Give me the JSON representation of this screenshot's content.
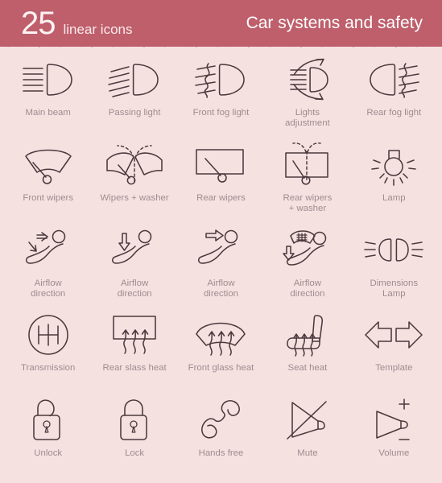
{
  "header": {
    "count": "25",
    "count_label": "linear icons",
    "title": "Car systems and safety",
    "background_color": "#bf5f6c",
    "text_color": "#ffffff"
  },
  "page": {
    "background_color": "#f6e1e1",
    "icon_stroke_color": "#4a3a3e",
    "caption_color": "#9e8c8f",
    "columns": 5,
    "rows": 5
  },
  "icons": [
    {
      "id": "main-beam",
      "label": "Main beam",
      "icon": "headlight-main-beam-icon"
    },
    {
      "id": "passing-light",
      "label": "Passing light",
      "icon": "headlight-passing-light-icon"
    },
    {
      "id": "front-fog-light",
      "label": "Front fog light",
      "icon": "headlight-front-fog-icon"
    },
    {
      "id": "lights-adjustment",
      "label": "Lights\nadjustment",
      "icon": "headlight-adjustment-icon"
    },
    {
      "id": "rear-fog-light",
      "label": "Rear fog light",
      "icon": "headlight-rear-fog-icon"
    },
    {
      "id": "front-wipers",
      "label": "Front wipers",
      "icon": "front-wipers-icon"
    },
    {
      "id": "wipers-washer",
      "label": "Wipers + washer",
      "icon": "wipers-washer-icon"
    },
    {
      "id": "rear-wipers",
      "label": "Rear wipers",
      "icon": "rear-wipers-icon"
    },
    {
      "id": "rear-wipers-washer",
      "label": "Rear wipers\n+ washer",
      "icon": "rear-wipers-washer-icon"
    },
    {
      "id": "lamp",
      "label": "Lamp",
      "icon": "lamp-icon"
    },
    {
      "id": "airflow-direction-1",
      "label": "Airflow\ndirection",
      "icon": "airflow-seat-upper-lower-icon"
    },
    {
      "id": "airflow-direction-2",
      "label": "Airflow\ndirection",
      "icon": "airflow-seat-down-icon"
    },
    {
      "id": "airflow-direction-3",
      "label": "Airflow\ndirection",
      "icon": "airflow-seat-front-icon"
    },
    {
      "id": "airflow-direction-4",
      "label": "Airflow\ndirection",
      "icon": "airflow-seat-windscreen-icon"
    },
    {
      "id": "dimensions-lamp",
      "label": "Dimensions\nLamp",
      "icon": "dimensions-lamp-icon"
    },
    {
      "id": "transmission",
      "label": "Transmission",
      "icon": "transmission-icon"
    },
    {
      "id": "rear-glass-heat",
      "label": "Rear slass heat",
      "icon": "rear-glass-heat-icon"
    },
    {
      "id": "front-glass-heat",
      "label": "Front glass heat",
      "icon": "front-glass-heat-icon"
    },
    {
      "id": "seat-heat",
      "label": "Seat heat",
      "icon": "seat-heat-icon"
    },
    {
      "id": "template",
      "label": "Template",
      "icon": "template-arrows-icon"
    },
    {
      "id": "unlock",
      "label": "Unlock",
      "icon": "unlock-padlock-icon"
    },
    {
      "id": "lock",
      "label": "Lock",
      "icon": "lock-padlock-icon"
    },
    {
      "id": "hands-free",
      "label": "Hands free",
      "icon": "handset-hands-free-icon"
    },
    {
      "id": "mute",
      "label": "Mute",
      "icon": "speaker-mute-icon"
    },
    {
      "id": "volume",
      "label": "Volume",
      "icon": "speaker-volume-icon"
    }
  ]
}
